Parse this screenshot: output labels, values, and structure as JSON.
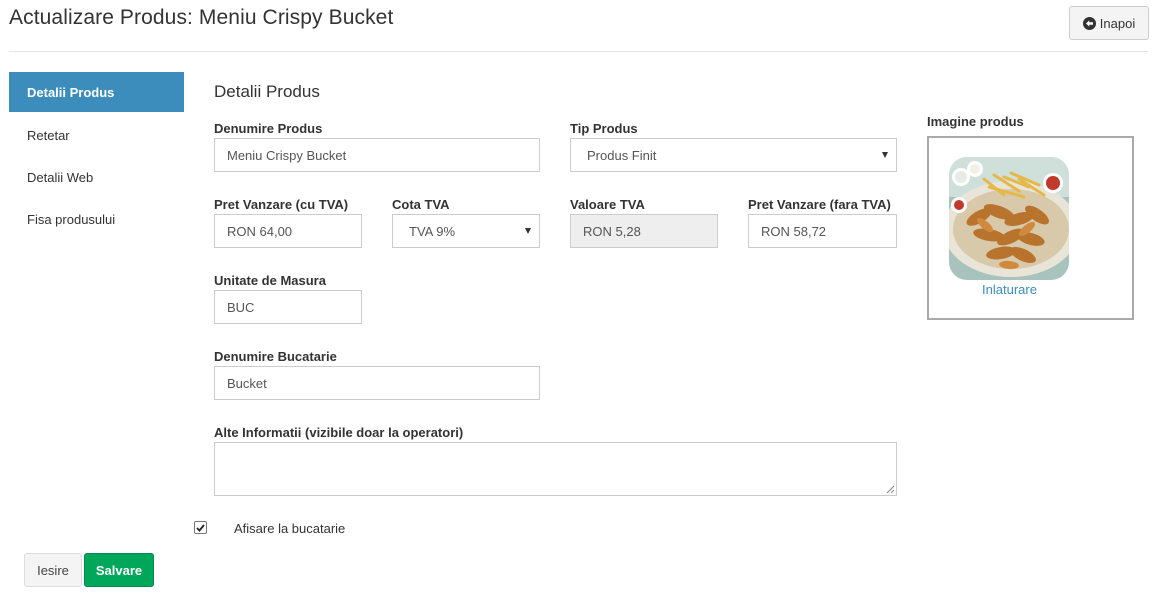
{
  "header": {
    "title": "Actualizare Produs: Meniu Crispy Bucket",
    "back_label": "Inapoi",
    "back_icon": "arrow-circle-left-icon"
  },
  "sidebar": {
    "items": [
      {
        "label": "Detalii Produs",
        "active": true
      },
      {
        "label": "Retetar",
        "active": false
      },
      {
        "label": "Detalii Web",
        "active": false
      },
      {
        "label": "Fisa produsului",
        "active": false
      }
    ]
  },
  "form": {
    "section_title": "Detalii Produs",
    "product_name": {
      "label": "Denumire Produs",
      "value": "Meniu Crispy Bucket"
    },
    "product_type": {
      "label": "Tip Produs",
      "value": "Produs Finit"
    },
    "price_with_vat": {
      "label": "Pret Vanzare (cu TVA)",
      "value": "RON  64,00"
    },
    "vat_rate": {
      "label": "Cota TVA",
      "value": "TVA 9%"
    },
    "vat_value": {
      "label": "Valoare TVA",
      "value": "RON  5,28"
    },
    "price_without_vat": {
      "label": "Pret Vanzare (fara TVA)",
      "value": "RON  58,72"
    },
    "unit": {
      "label": "Unitate de Masura",
      "value": "BUC"
    },
    "kitchen_name": {
      "label": "Denumire Bucatarie",
      "value": "Bucket"
    },
    "other_info": {
      "label": "Alte Informatii (vizibile doar la operatori)",
      "value": ""
    },
    "show_in_kitchen": {
      "label": "Afisare la bucatarie",
      "checked": true
    }
  },
  "image": {
    "label": "Imagine produs",
    "remove_label": "Inlaturare"
  },
  "footer": {
    "exit_label": "Iesire",
    "save_label": "Salvare"
  },
  "colors": {
    "accent": "#3c8dbc",
    "save": "#00a65a"
  }
}
